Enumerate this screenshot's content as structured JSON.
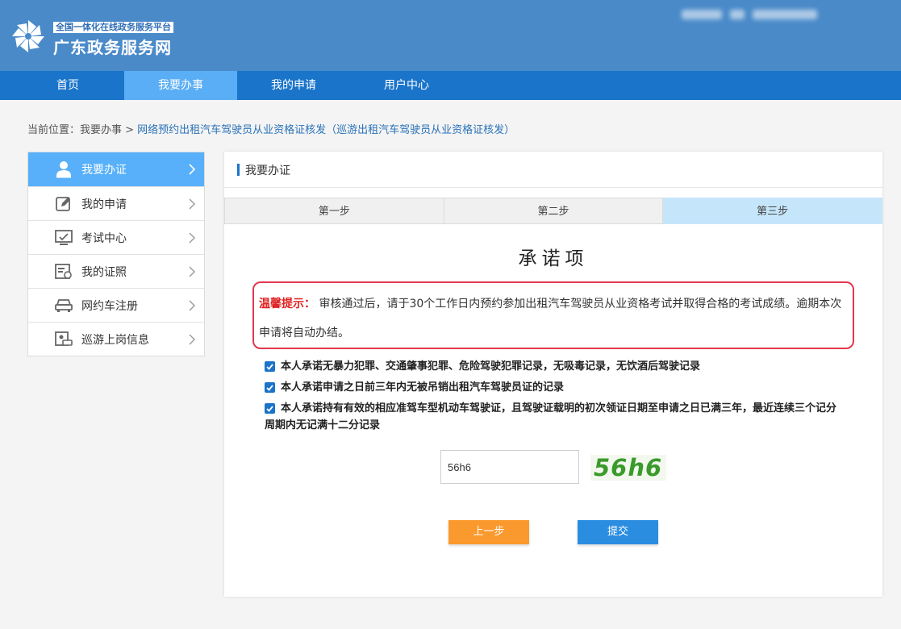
{
  "header": {
    "brand_tag": "全国一体化在线政务服务平台",
    "brand_title": "广东政务服务网",
    "bg_color": "#4a8ac9"
  },
  "nav": {
    "items": [
      "首页",
      "我要办事",
      "我的申请",
      "用户中心"
    ],
    "active": "我要办事"
  },
  "breadcrumb": {
    "prefix": "当前位置：我要办事 >",
    "link": "网络预约出租汽车驾驶员从业资格证核发（巡游出租汽车驾驶员从业资格证核发）"
  },
  "sidebar": {
    "items": [
      {
        "label": "我要办证",
        "icon": "user-icon",
        "active": true
      },
      {
        "label": "我的申请",
        "icon": "edit-icon",
        "active": false
      },
      {
        "label": "考试中心",
        "icon": "monitor-icon",
        "active": false
      },
      {
        "label": "我的证照",
        "icon": "certificate-icon",
        "active": false
      },
      {
        "label": "网约车注册",
        "icon": "car-icon",
        "active": false
      },
      {
        "label": "巡游上岗信息",
        "icon": "taxi-icon",
        "active": false
      }
    ]
  },
  "panel": {
    "title": "我要办证",
    "steps": [
      "第一步",
      "第二步",
      "第三步"
    ],
    "active_step": "第三步",
    "commitment_title": "承诺项",
    "notice_tag": "温馨提示：",
    "notice_text": "审核通过后，请于30个工作日内预约参加出租汽车驾驶员从业资格考试并取得合格的考试成绩。逾期本次申请将自动办结。",
    "promises": [
      {
        "text": "本人承诺无暴力犯罪、交通肇事犯罪、危险驾驶犯罪记录，无吸毒记录，无饮酒后驾驶记录",
        "checked": true
      },
      {
        "text": "本人承诺申请之日前三年内无被吊销出租汽车驾驶员证的记录",
        "checked": true
      },
      {
        "text": "本人承诺持有有效的相应准驾车型机动车驾驶证，且驾驶证载明的初次领证日期至申请之日已满三年，最近连续三个记分周期内无记满十二分记录",
        "checked": true
      }
    ],
    "captcha": {
      "input_value": "56h6",
      "image_text": "56h6"
    },
    "buttons": {
      "prev": "上一步",
      "submit": "提交"
    }
  }
}
